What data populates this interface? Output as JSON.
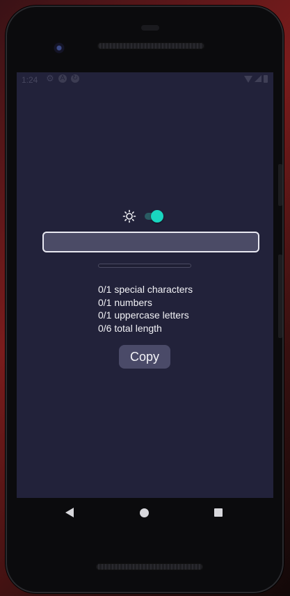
{
  "statusbar": {
    "time": "1:24",
    "icons_left": [
      "gear-icon",
      "a-circle-icon",
      "sync-circle-icon"
    ],
    "icons_right": [
      "wifi-icon",
      "signal-icon",
      "battery-icon"
    ]
  },
  "theme_toggle": {
    "icon": "sun-icon",
    "state": "on",
    "accent_color": "#19d6c0"
  },
  "password_input": {
    "value": "",
    "placeholder": ""
  },
  "strength_meter": {
    "progress": 0
  },
  "requirements": [
    "0/1 special characters",
    "0/1 numbers",
    "0/1 uppercase letters",
    "0/6 total length"
  ],
  "copy_button": {
    "label": "Copy"
  },
  "navbar": {
    "icons": [
      "back-icon",
      "home-icon",
      "recents-icon"
    ]
  },
  "colors": {
    "screen_background": "#22223a",
    "input_background": "#4b4b66",
    "button_background": "#4a4a68",
    "text": "#f2f2f6"
  }
}
